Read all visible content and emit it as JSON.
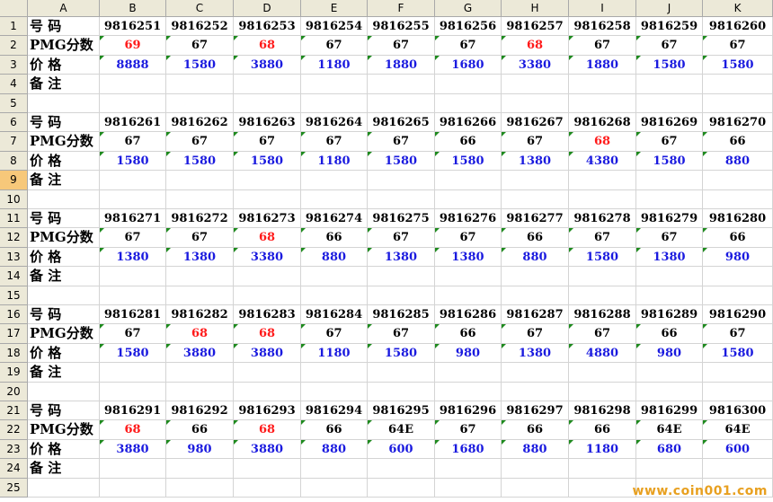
{
  "columns": [
    "A",
    "B",
    "C",
    "D",
    "E",
    "F",
    "G",
    "H",
    "I",
    "J",
    "K"
  ],
  "row_numbers": [
    "1",
    "2",
    "3",
    "4",
    "5",
    "6",
    "7",
    "8",
    "9",
    "10",
    "11",
    "12",
    "13",
    "14",
    "15",
    "16",
    "17",
    "18",
    "19",
    "20",
    "21",
    "22",
    "23",
    "24",
    "25"
  ],
  "selected_row": "9",
  "labels": {
    "number": "号  码",
    "pmg": "PMG分数",
    "price": "价  格",
    "note": "备  注"
  },
  "colors": {
    "red_score": "#ff1a1a",
    "price_blue": "#1a1adf",
    "header_bg": "#ece9d8",
    "selected_row_bg": "#f7c87a",
    "marker_green": "#1e8a1e"
  },
  "blocks": [
    {
      "numbers": [
        "9816251",
        "9816252",
        "9816253",
        "9816254",
        "9816255",
        "9816256",
        "9816257",
        "9816258",
        "9816259",
        "9816260"
      ],
      "scores": [
        "69",
        "67",
        "68",
        "67",
        "67",
        "67",
        "68",
        "67",
        "67",
        "67"
      ],
      "score_red": [
        true,
        false,
        true,
        false,
        false,
        false,
        true,
        false,
        false,
        false
      ],
      "prices": [
        "8888",
        "1580",
        "3880",
        "1180",
        "1880",
        "1680",
        "3380",
        "1880",
        "1580",
        "1580"
      ]
    },
    {
      "numbers": [
        "9816261",
        "9816262",
        "9816263",
        "9816264",
        "9816265",
        "9816266",
        "9816267",
        "9816268",
        "9816269",
        "9816270"
      ],
      "scores": [
        "67",
        "67",
        "67",
        "67",
        "67",
        "66",
        "67",
        "68",
        "67",
        "66"
      ],
      "score_red": [
        false,
        false,
        false,
        false,
        false,
        false,
        false,
        true,
        false,
        false
      ],
      "prices": [
        "1580",
        "1580",
        "1580",
        "1180",
        "1580",
        "1580",
        "1380",
        "4380",
        "1580",
        "880"
      ]
    },
    {
      "numbers": [
        "9816271",
        "9816272",
        "9816273",
        "9816274",
        "9816275",
        "9816276",
        "9816277",
        "9816278",
        "9816279",
        "9816280"
      ],
      "scores": [
        "67",
        "67",
        "68",
        "66",
        "67",
        "67",
        "66",
        "67",
        "67",
        "66"
      ],
      "score_red": [
        false,
        false,
        true,
        false,
        false,
        false,
        false,
        false,
        false,
        false
      ],
      "prices": [
        "1380",
        "1380",
        "3380",
        "880",
        "1380",
        "1380",
        "880",
        "1580",
        "1380",
        "980"
      ]
    },
    {
      "numbers": [
        "9816281",
        "9816282",
        "9816283",
        "9816284",
        "9816285",
        "9816286",
        "9816287",
        "9816288",
        "9816289",
        "9816290"
      ],
      "scores": [
        "67",
        "68",
        "68",
        "67",
        "67",
        "66",
        "67",
        "67",
        "66",
        "67"
      ],
      "score_red": [
        false,
        true,
        true,
        false,
        false,
        false,
        false,
        false,
        false,
        false
      ],
      "prices": [
        "1580",
        "3880",
        "3880",
        "1180",
        "1580",
        "980",
        "1380",
        "4880",
        "980",
        "1580"
      ]
    },
    {
      "numbers": [
        "9816291",
        "9816292",
        "9816293",
        "9816294",
        "9816295",
        "9816296",
        "9816297",
        "9816298",
        "9816299",
        "9816300"
      ],
      "scores": [
        "68",
        "66",
        "68",
        "66",
        "64E",
        "67",
        "66",
        "66",
        "64E",
        "64E"
      ],
      "score_red": [
        true,
        false,
        true,
        false,
        false,
        false,
        false,
        false,
        false,
        false
      ],
      "prices": [
        "3880",
        "980",
        "3880",
        "880",
        "600",
        "1680",
        "880",
        "1180",
        "680",
        "600"
      ]
    }
  ],
  "watermark": "www.coin001.com"
}
